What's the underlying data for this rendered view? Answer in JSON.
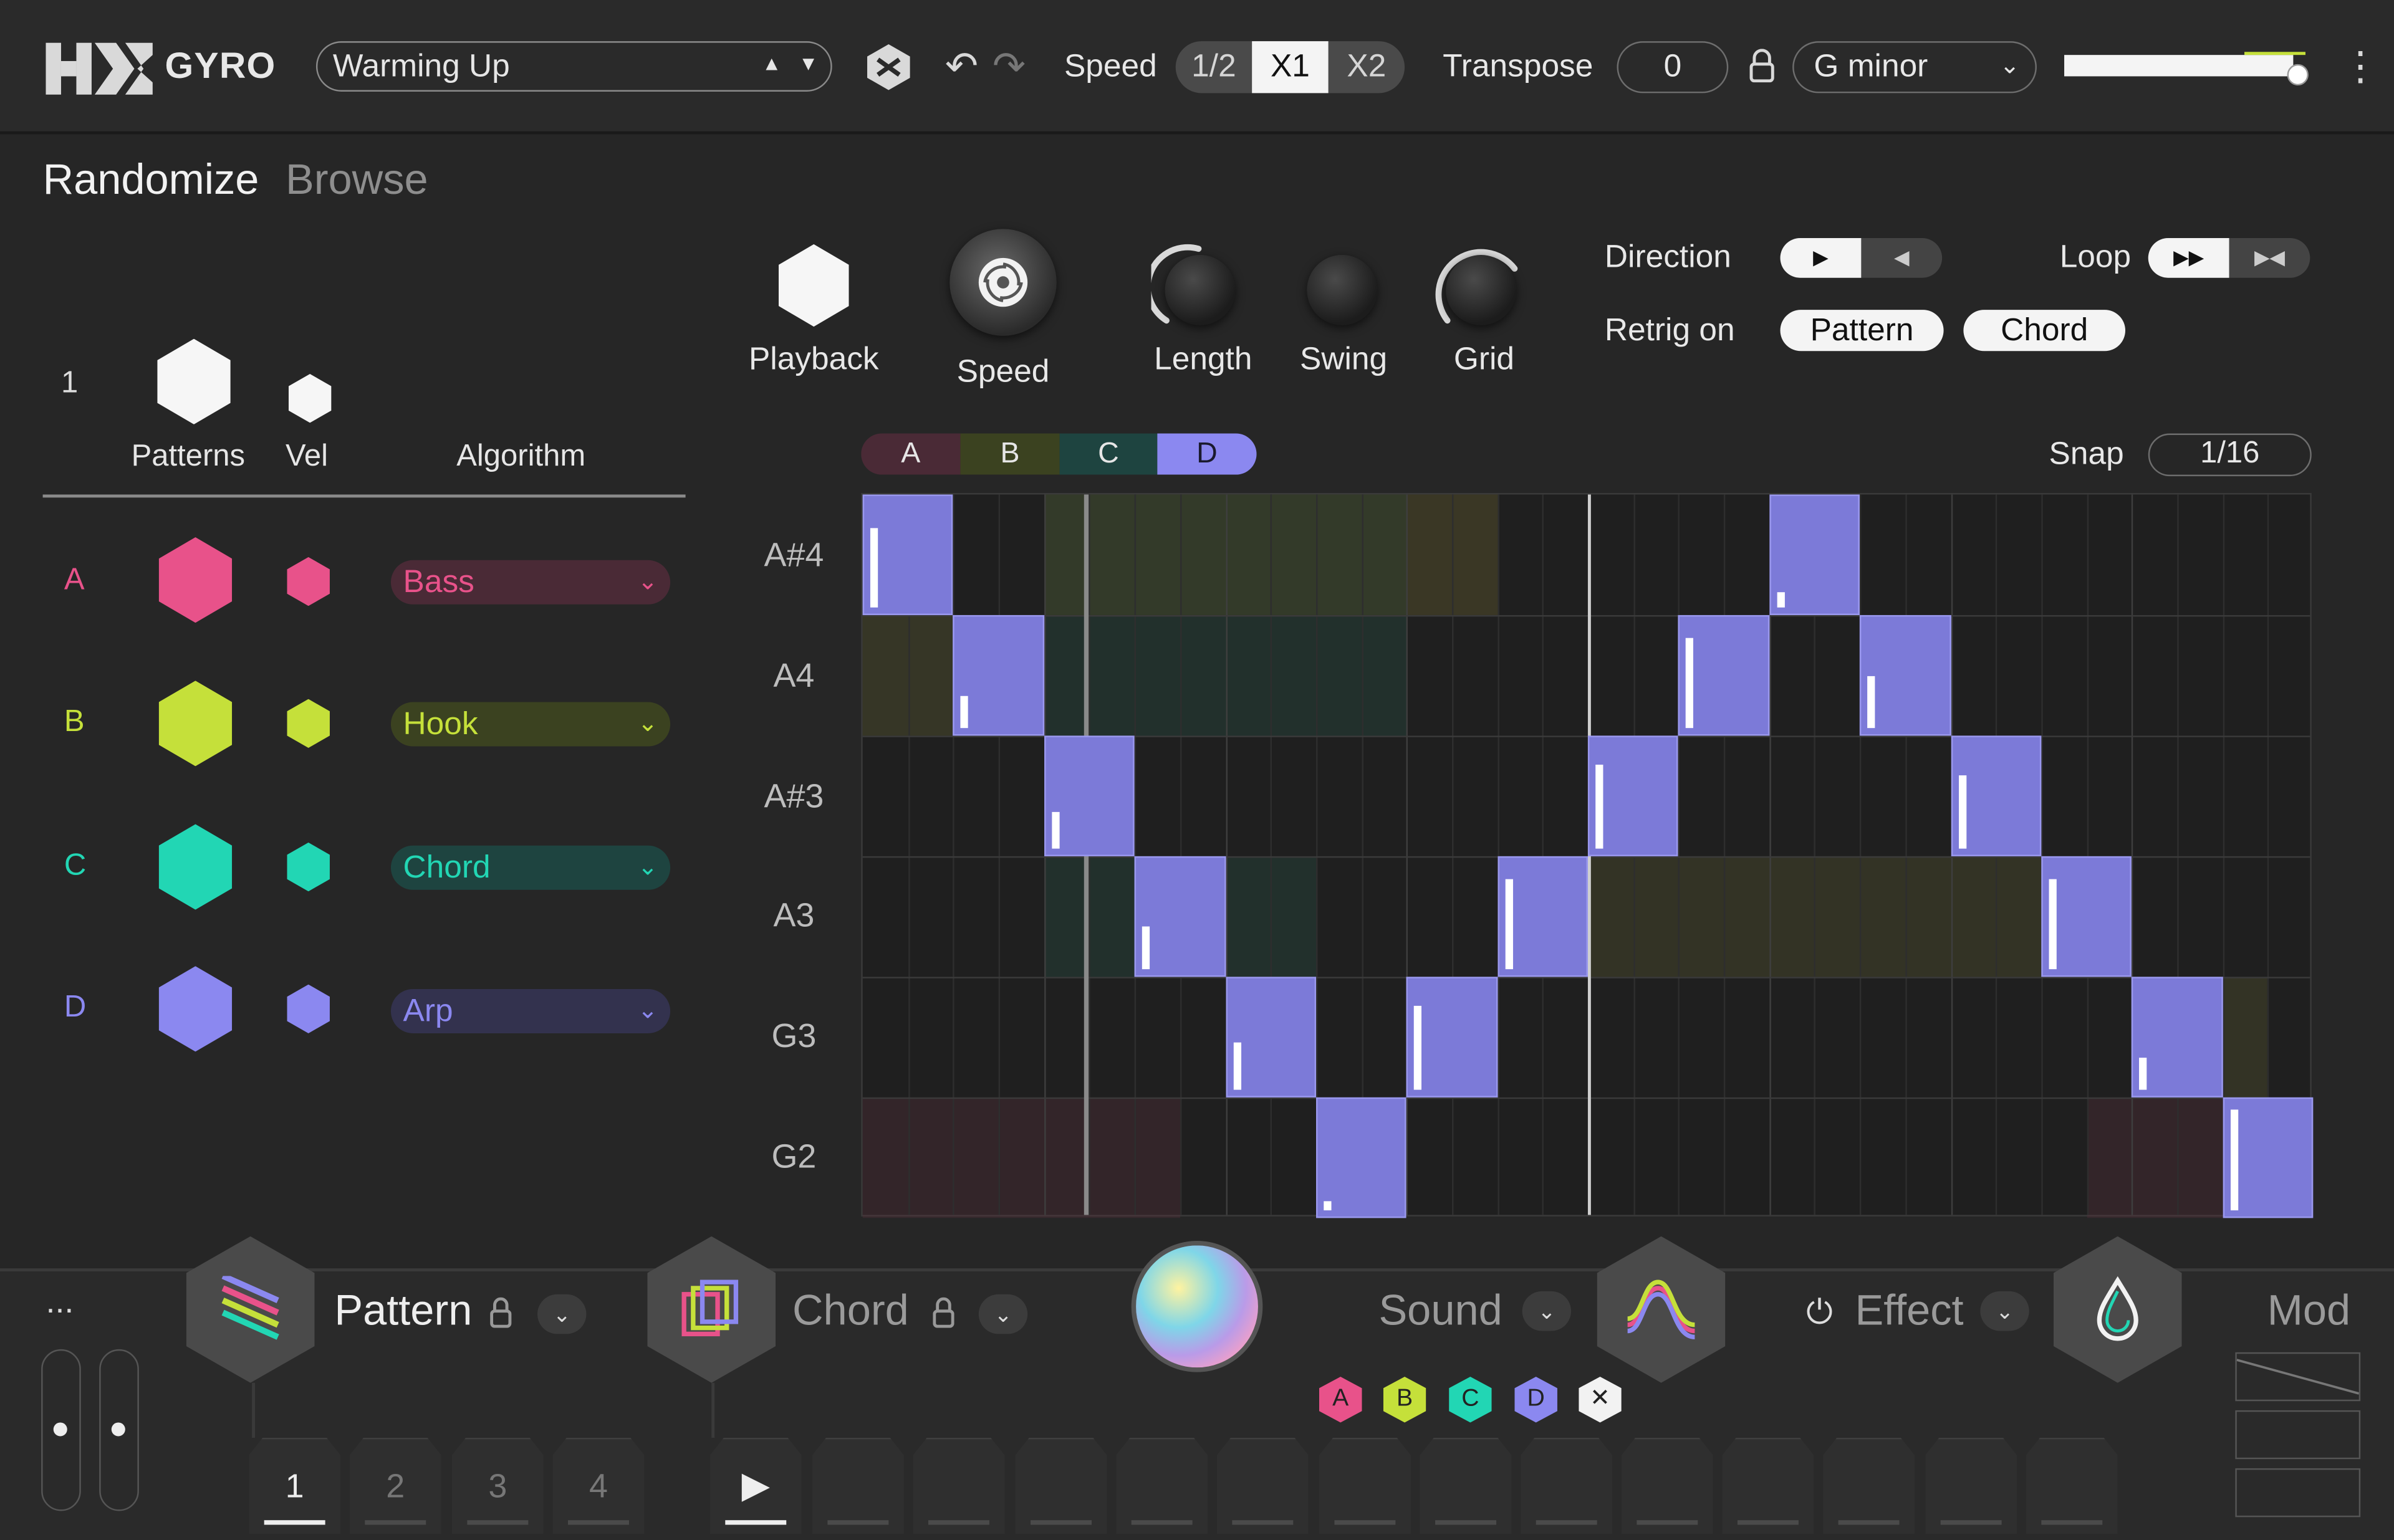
{
  "header": {
    "brand": "GYRO",
    "preset_name": "Warming Up",
    "speed_label": "Speed",
    "speed_options": [
      "1/2",
      "X1",
      "X2"
    ],
    "speed_selected": "X1",
    "transpose_label": "Transpose",
    "transpose_value": "0",
    "key": "G minor",
    "volume_level": 0.95
  },
  "left": {
    "tabs": [
      "Randomize",
      "Browse"
    ],
    "row_number": "1",
    "col_patterns": "Patterns",
    "col_vel": "Vel",
    "col_algorithm": "Algorithm",
    "rows": [
      {
        "id": "A",
        "algorithm": "Bass",
        "color": "#e8528a"
      },
      {
        "id": "B",
        "algorithm": "Hook",
        "color": "#c5e03a"
      },
      {
        "id": "C",
        "algorithm": "Chord",
        "color": "#22d6b4"
      },
      {
        "id": "D",
        "algorithm": "Arp",
        "color": "#8b88f0"
      }
    ]
  },
  "controls": {
    "playback": "Playback",
    "speed": "Speed",
    "length": "Length",
    "swing": "Swing",
    "grid": "Grid",
    "direction_label": "Direction",
    "loop_label": "Loop",
    "retrig_label": "Retrig on",
    "retrig_options": [
      "Pattern",
      "Chord"
    ]
  },
  "piano_roll": {
    "pattern_tabs": [
      "A",
      "B",
      "C",
      "D"
    ],
    "active_pattern": "D",
    "snap_label": "Snap",
    "snap_value": "1/16",
    "note_labels": [
      "A#4",
      "A4",
      "A#3",
      "A3",
      "G3",
      "G2"
    ]
  },
  "bottom": {
    "more": "...",
    "pattern": "Pattern",
    "chord": "Chord",
    "sound": "Sound",
    "effect": "Effect",
    "mod": "Mod",
    "slots": [
      "1",
      "2",
      "3",
      "4"
    ],
    "selected_slot": "1",
    "layer_badges": [
      "A",
      "B",
      "C",
      "D"
    ]
  }
}
